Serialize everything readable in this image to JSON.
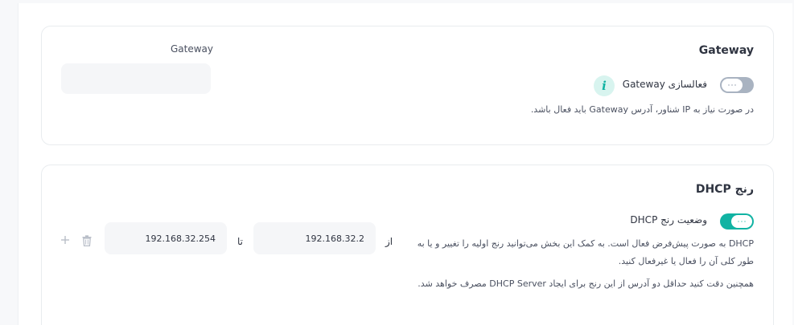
{
  "gateway_section": {
    "title": "Gateway",
    "toggle_label": "فعالسازی Gateway",
    "toggle_state": "off",
    "description": "در صورت نیاز به IP شناور، آدرس Gateway باید فعال باشد.",
    "field_label": "Gateway",
    "field_value": "",
    "info_icon": "info-icon"
  },
  "dhcp_section": {
    "title": "رنج DHCP",
    "toggle_label": "وضعیت رنج DHCP",
    "toggle_state": "on",
    "description_1": "DHCP به صورت پیش‌فرض فعال است. به کمک این بخش می‌توانید رنج اولیه را تغییر و یا به طور کلی آن را فعال یا غیرفعال کنید.",
    "description_2": "همچنین دقت کنید حداقل دو آدرس از این رنج برای ایجاد DHCP Server مصرف خواهد شد.",
    "from_label": "از",
    "from_value": "192.168.32.2",
    "to_label": "تا",
    "to_value": "192.168.32.254",
    "delete_icon": "trash-icon",
    "add_icon": "plus-icon"
  },
  "colors": {
    "accent": "#11b3a3",
    "toggle_off": "#a9b3c1",
    "input_bg": "#f5f6f8"
  }
}
